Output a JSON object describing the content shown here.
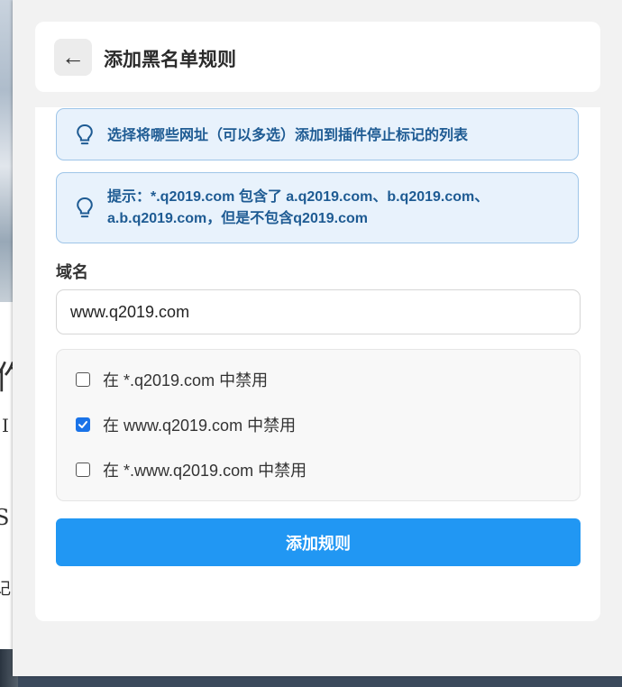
{
  "header": {
    "back_icon": "←",
    "title": "添加黑名单规则"
  },
  "tips": [
    {
      "icon": "lightbulb-icon",
      "text": "选择将哪些网址（可以多选）添加到插件停止标记的列表"
    },
    {
      "icon": "lightbulb-icon",
      "text": "提示：*.q2019.com 包含了 a.q2019.com、b.q2019.com、a.b.q2019.com，但是不包含q2019.com"
    }
  ],
  "domain": {
    "label": "域名",
    "value": "www.q2019.com"
  },
  "options": [
    {
      "label": "在 *.q2019.com 中禁用",
      "checked": false
    },
    {
      "label": "在 www.q2019.com 中禁用",
      "checked": true
    },
    {
      "label": "在 *.www.q2019.com 中禁用",
      "checked": false
    }
  ],
  "submit_label": "添加规则",
  "background_page": {
    "glyphs": [
      "作",
      "I",
      "S",
      "记"
    ]
  },
  "colors": {
    "accent": "#2197f3",
    "tip_background": "#e8f2fc",
    "tip_text": "#1e5b93",
    "checkbox_checked": "#1a73e8"
  }
}
